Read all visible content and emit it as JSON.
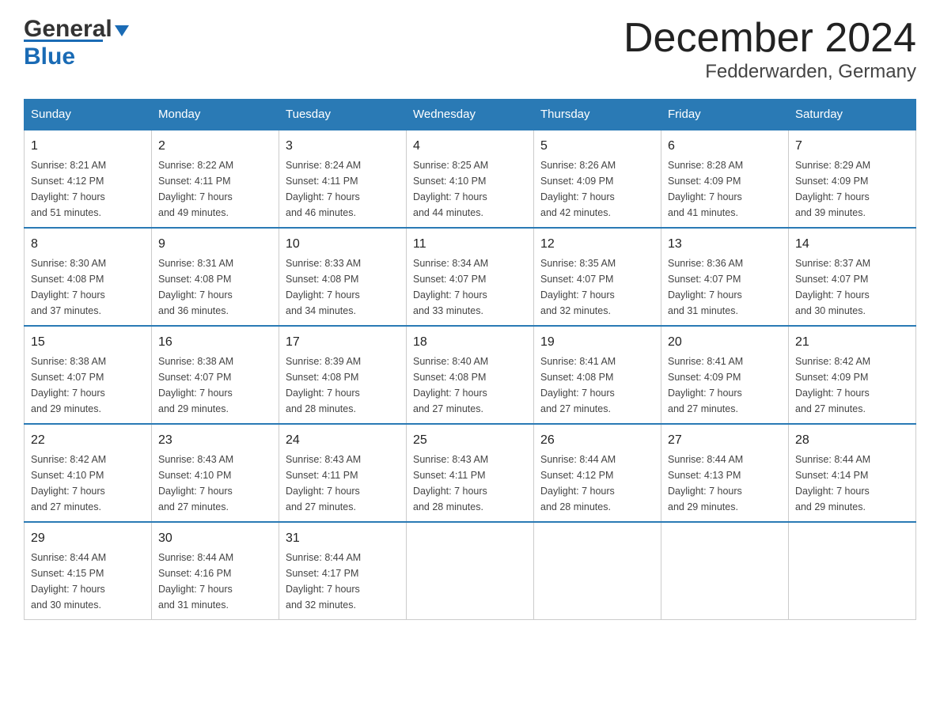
{
  "header": {
    "logo": {
      "part1": "General",
      "part2": "Blue"
    },
    "title": "December 2024",
    "location": "Fedderwarden, Germany"
  },
  "days_of_week": [
    "Sunday",
    "Monday",
    "Tuesday",
    "Wednesday",
    "Thursday",
    "Friday",
    "Saturday"
  ],
  "weeks": [
    [
      {
        "day": "1",
        "sunrise": "8:21 AM",
        "sunset": "4:12 PM",
        "daylight": "7 hours and 51 minutes."
      },
      {
        "day": "2",
        "sunrise": "8:22 AM",
        "sunset": "4:11 PM",
        "daylight": "7 hours and 49 minutes."
      },
      {
        "day": "3",
        "sunrise": "8:24 AM",
        "sunset": "4:11 PM",
        "daylight": "7 hours and 46 minutes."
      },
      {
        "day": "4",
        "sunrise": "8:25 AM",
        "sunset": "4:10 PM",
        "daylight": "7 hours and 44 minutes."
      },
      {
        "day": "5",
        "sunrise": "8:26 AM",
        "sunset": "4:09 PM",
        "daylight": "7 hours and 42 minutes."
      },
      {
        "day": "6",
        "sunrise": "8:28 AM",
        "sunset": "4:09 PM",
        "daylight": "7 hours and 41 minutes."
      },
      {
        "day": "7",
        "sunrise": "8:29 AM",
        "sunset": "4:09 PM",
        "daylight": "7 hours and 39 minutes."
      }
    ],
    [
      {
        "day": "8",
        "sunrise": "8:30 AM",
        "sunset": "4:08 PM",
        "daylight": "7 hours and 37 minutes."
      },
      {
        "day": "9",
        "sunrise": "8:31 AM",
        "sunset": "4:08 PM",
        "daylight": "7 hours and 36 minutes."
      },
      {
        "day": "10",
        "sunrise": "8:33 AM",
        "sunset": "4:08 PM",
        "daylight": "7 hours and 34 minutes."
      },
      {
        "day": "11",
        "sunrise": "8:34 AM",
        "sunset": "4:07 PM",
        "daylight": "7 hours and 33 minutes."
      },
      {
        "day": "12",
        "sunrise": "8:35 AM",
        "sunset": "4:07 PM",
        "daylight": "7 hours and 32 minutes."
      },
      {
        "day": "13",
        "sunrise": "8:36 AM",
        "sunset": "4:07 PM",
        "daylight": "7 hours and 31 minutes."
      },
      {
        "day": "14",
        "sunrise": "8:37 AM",
        "sunset": "4:07 PM",
        "daylight": "7 hours and 30 minutes."
      }
    ],
    [
      {
        "day": "15",
        "sunrise": "8:38 AM",
        "sunset": "4:07 PM",
        "daylight": "7 hours and 29 minutes."
      },
      {
        "day": "16",
        "sunrise": "8:38 AM",
        "sunset": "4:07 PM",
        "daylight": "7 hours and 29 minutes."
      },
      {
        "day": "17",
        "sunrise": "8:39 AM",
        "sunset": "4:08 PM",
        "daylight": "7 hours and 28 minutes."
      },
      {
        "day": "18",
        "sunrise": "8:40 AM",
        "sunset": "4:08 PM",
        "daylight": "7 hours and 27 minutes."
      },
      {
        "day": "19",
        "sunrise": "8:41 AM",
        "sunset": "4:08 PM",
        "daylight": "7 hours and 27 minutes."
      },
      {
        "day": "20",
        "sunrise": "8:41 AM",
        "sunset": "4:09 PM",
        "daylight": "7 hours and 27 minutes."
      },
      {
        "day": "21",
        "sunrise": "8:42 AM",
        "sunset": "4:09 PM",
        "daylight": "7 hours and 27 minutes."
      }
    ],
    [
      {
        "day": "22",
        "sunrise": "8:42 AM",
        "sunset": "4:10 PM",
        "daylight": "7 hours and 27 minutes."
      },
      {
        "day": "23",
        "sunrise": "8:43 AM",
        "sunset": "4:10 PM",
        "daylight": "7 hours and 27 minutes."
      },
      {
        "day": "24",
        "sunrise": "8:43 AM",
        "sunset": "4:11 PM",
        "daylight": "7 hours and 27 minutes."
      },
      {
        "day": "25",
        "sunrise": "8:43 AM",
        "sunset": "4:11 PM",
        "daylight": "7 hours and 28 minutes."
      },
      {
        "day": "26",
        "sunrise": "8:44 AM",
        "sunset": "4:12 PM",
        "daylight": "7 hours and 28 minutes."
      },
      {
        "day": "27",
        "sunrise": "8:44 AM",
        "sunset": "4:13 PM",
        "daylight": "7 hours and 29 minutes."
      },
      {
        "day": "28",
        "sunrise": "8:44 AM",
        "sunset": "4:14 PM",
        "daylight": "7 hours and 29 minutes."
      }
    ],
    [
      {
        "day": "29",
        "sunrise": "8:44 AM",
        "sunset": "4:15 PM",
        "daylight": "7 hours and 30 minutes."
      },
      {
        "day": "30",
        "sunrise": "8:44 AM",
        "sunset": "4:16 PM",
        "daylight": "7 hours and 31 minutes."
      },
      {
        "day": "31",
        "sunrise": "8:44 AM",
        "sunset": "4:17 PM",
        "daylight": "7 hours and 32 minutes."
      },
      null,
      null,
      null,
      null
    ]
  ],
  "labels": {
    "sunrise": "Sunrise:",
    "sunset": "Sunset:",
    "daylight": "Daylight:"
  }
}
